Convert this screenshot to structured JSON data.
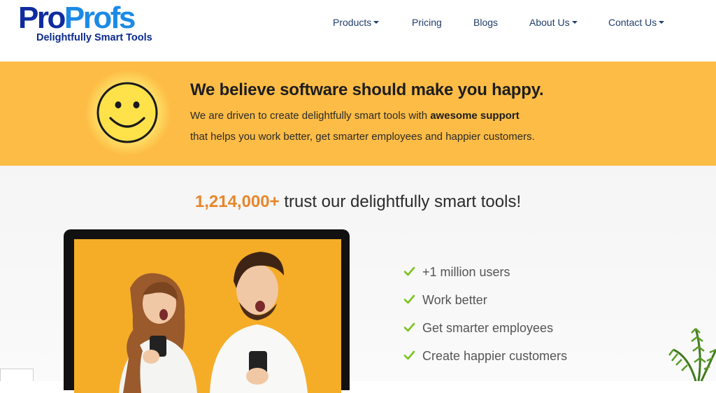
{
  "brand": {
    "logo_pro": "Pro",
    "logo_profs": "Profs",
    "tagline": "Delightfully Smart Tools"
  },
  "nav": [
    {
      "label": "Products",
      "dropdown": true
    },
    {
      "label": "Pricing",
      "dropdown": false
    },
    {
      "label": "Blogs",
      "dropdown": false
    },
    {
      "label": "About Us",
      "dropdown": true
    },
    {
      "label": "Contact Us",
      "dropdown": true
    }
  ],
  "banner": {
    "title": "We believe software should make you happy.",
    "line1_pre": "We are driven to create delightfully smart tools with ",
    "line1_bold": "awesome support",
    "line2": "that helps you work better, get smarter employees and happier customers.",
    "icon": "smiley-face-icon"
  },
  "trust": {
    "count": "1,214,000+",
    "text": " trust our delightfully smart tools!"
  },
  "checklist": [
    {
      "label": "+1 million users",
      "icon": "check-icon"
    },
    {
      "label": "Work better",
      "icon": "check-icon"
    },
    {
      "label": "Get smarter employees",
      "icon": "check-icon"
    },
    {
      "label": "Create happier customers",
      "icon": "check-icon"
    }
  ],
  "colors": {
    "banner_bg": "#fdbc45",
    "accent_orange": "#e8862a",
    "check_green": "#7cc21e",
    "logo_dark_blue": "#0f2b9f",
    "logo_light_blue": "#1b8ae6"
  }
}
